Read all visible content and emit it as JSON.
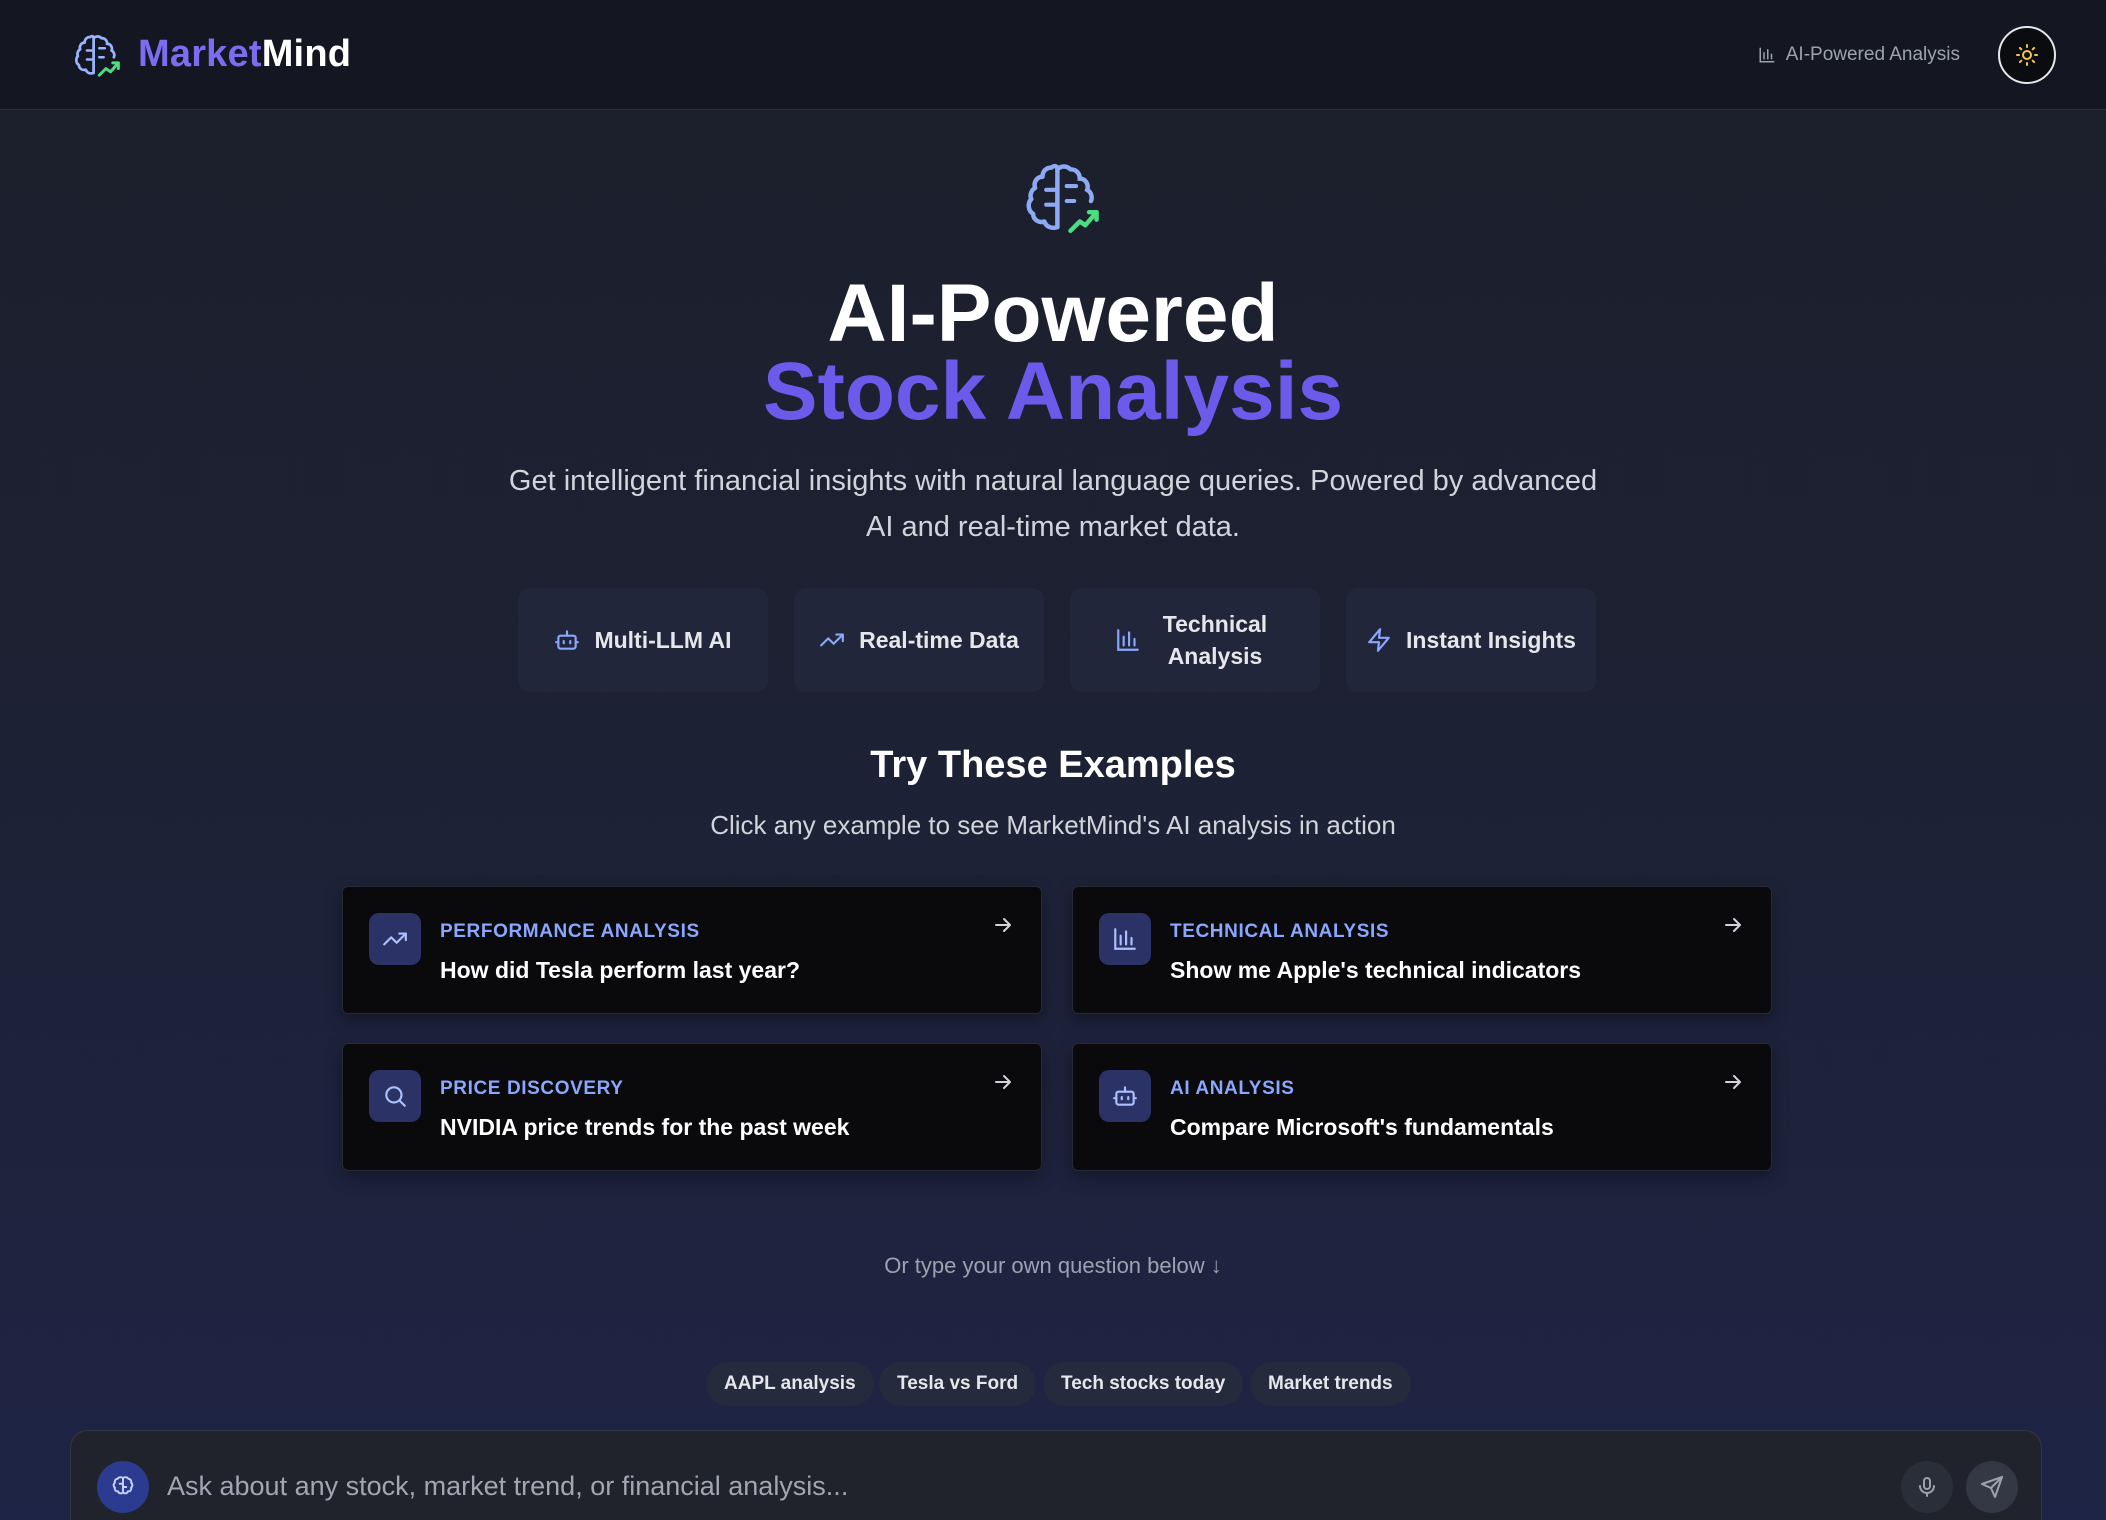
{
  "header": {
    "brand_part1": "Market",
    "brand_part2": "Mind",
    "badge_label": "AI-Powered Analysis",
    "logo_icon": "brain-chart-icon",
    "theme_icon": "sun-icon"
  },
  "hero": {
    "title_line1": "AI-Powered",
    "title_line2": "Stock Analysis",
    "subtitle": "Get intelligent financial insights with natural language queries. Powered by advanced AI and real-time market data."
  },
  "features": [
    {
      "label": "Multi-LLM AI",
      "icon": "bot-icon"
    },
    {
      "label": "Real-time Data",
      "icon": "trending-up-icon"
    },
    {
      "label": "Technical Analysis",
      "icon": "bar-chart-icon"
    },
    {
      "label": "Instant Insights",
      "icon": "zap-icon"
    }
  ],
  "examples": {
    "title": "Try These Examples",
    "subtitle": "Click any example to see MarketMind's AI analysis in action",
    "cards": [
      {
        "category": "PERFORMANCE ANALYSIS",
        "question": "How did Tesla perform last year?",
        "icon": "trending-up-icon"
      },
      {
        "category": "TECHNICAL ANALYSIS",
        "question": "Show me Apple's technical indicators",
        "icon": "bar-chart-icon"
      },
      {
        "category": "PRICE DISCOVERY",
        "question": "NVIDIA price trends for the past week",
        "icon": "search-icon"
      },
      {
        "category": "AI ANALYSIS",
        "question": "Compare Microsoft's fundamentals",
        "icon": "bot-icon"
      }
    ]
  },
  "hint": "Or type your own question below ↓",
  "chips": [
    "AAPL analysis",
    "Tesla vs Ford",
    "Tech stocks today",
    "Market trends"
  ],
  "chat": {
    "placeholder": "Ask about any stock, market trend, or financial analysis...",
    "value": ""
  },
  "colors": {
    "accent": "#6c5bea",
    "category_blue": "#8aa7ff",
    "logo_green": "#4ade80"
  }
}
